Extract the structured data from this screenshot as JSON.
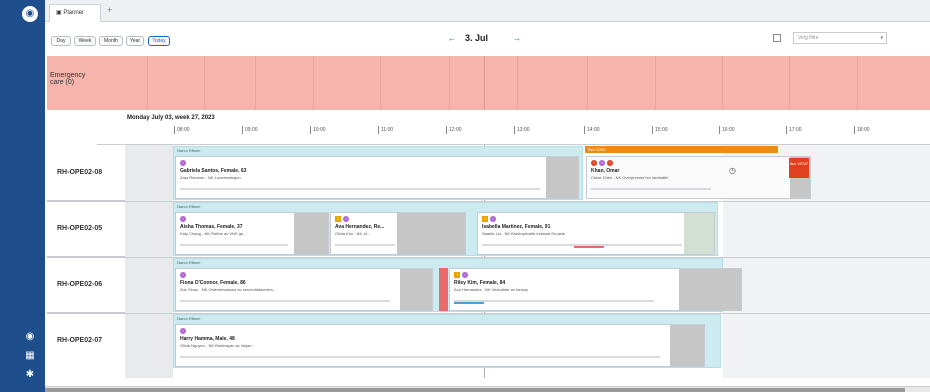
{
  "app": {
    "tab_label": "Planner",
    "tab_add": "+"
  },
  "toolbar": {
    "views": [
      "Day",
      "Week",
      "Month",
      "Year",
      "Today"
    ],
    "date_label": "3. Jul",
    "prev_arrow": "←",
    "next_arrow": "→",
    "select_placeholder": "Velg filtre",
    "select_caret": "▾"
  },
  "emergency": {
    "label": "Emergency care (0)"
  },
  "timeline": {
    "date_header": "Monday July 03, week 27, 2023",
    "times": [
      "08:00",
      "09:00",
      "10:00",
      "11:00",
      "12:00",
      "13:00",
      "14:00",
      "15:00",
      "16:00",
      "17:00",
      "18:00"
    ]
  },
  "rows": [
    {
      "label": "RH-OPE02-08",
      "band_label": "Narco Råsen",
      "cards": [
        {
          "name": "Gabriela Santos, Female, 63",
          "sub": "Zara Rahman - NK Lunereseksjon"
        },
        {
          "name": "Khan, Omar",
          "sub": "Chloe Chen - NK Overpremiert ex lambaffe!"
        }
      ],
      "orange_label": "Rev 2023",
      "red_tag": "Avc VENT"
    },
    {
      "label": "RH-OPE02-05",
      "band_label": "Narco Råsen",
      "cards": [
        {
          "name": "Aisha Thomas, Female, 37",
          "sub": "Katy Chang - NK Rubbe av VNS ge..."
        },
        {
          "name": "Ava Hernandez, Re...",
          "sub": "Olivia Kim - NK Je..."
        },
        {
          "name": "Isabella Martinez, Female, 91",
          "sub": "Saadia Liu - NK Bravtuphostik intrinsal Ernasie"
        }
      ]
    },
    {
      "label": "RH-OPE02-06",
      "band_label": "Narco Råsen",
      "cards": [
        {
          "name": "Fiona O'Connor, Female, 86",
          "sub": "Zoe Sloun - NK Ostentetomizes av cervindisikkerhra..."
        },
        {
          "name": "Riley Kim, Female, 84",
          "sub": "Ava Hernandez - NK Vevbahtet av forlaoy"
        }
      ]
    },
    {
      "label": "RH-OPE02-07",
      "band_label": "Narco Råsen",
      "cards": [
        {
          "name": "Harry Hamma, Male, 48",
          "sub": "Olivia Nguyen - NK Brektrayan av Inkjan"
        }
      ]
    }
  ],
  "colors": {
    "sidebar": "#1e4f8c",
    "emergency": "#f5b4ac",
    "band": "#ccebf0",
    "accent_orange": "#ee8b16",
    "accent_red": "#e0401f",
    "purple_badge": "#b066d6"
  }
}
